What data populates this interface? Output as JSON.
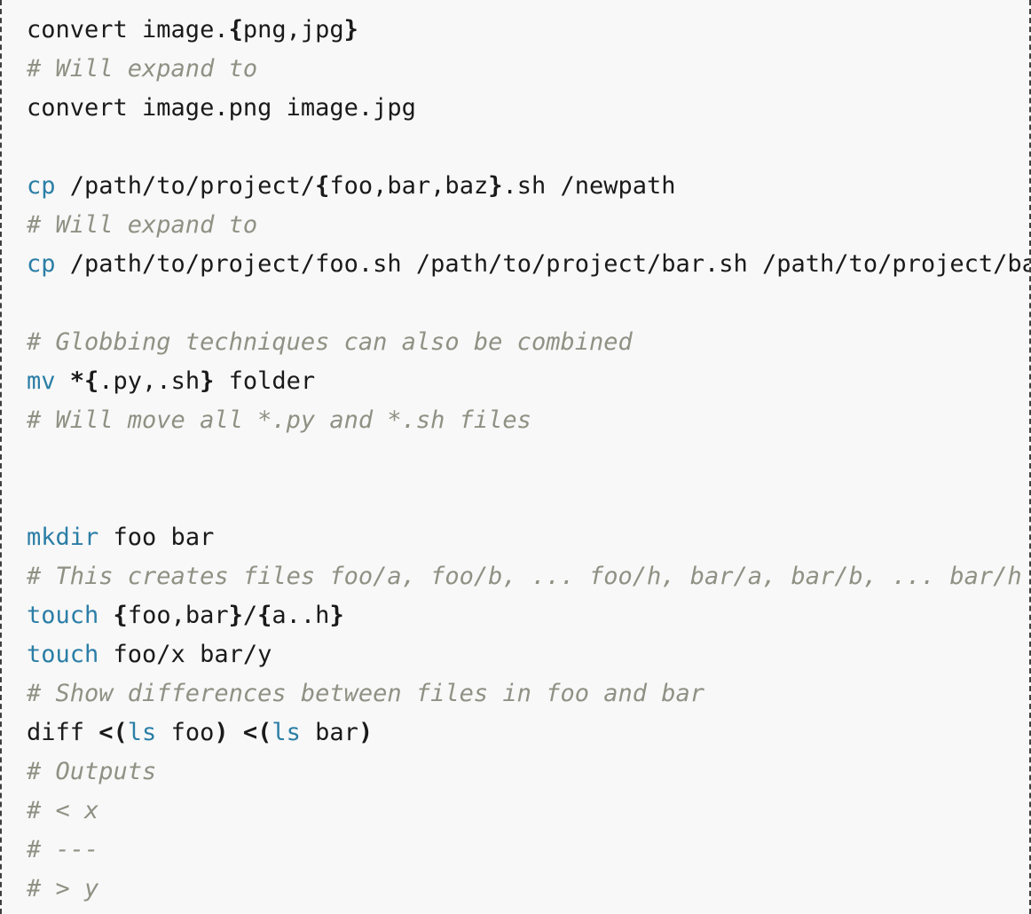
{
  "block": {
    "language": "bash",
    "background_color": "#f8f8f8",
    "border_style": "dashed",
    "border_color": "#3f3f3f",
    "colors": {
      "text": "#1a1a1a",
      "keyword": "#2b7ea6",
      "comment": "#8f9184",
      "metachar": "#1a1a1a"
    }
  },
  "lines": [
    {
      "id": "line-1",
      "type": "command",
      "text": "convert image.{png,jpg}",
      "tokens": [
        {
          "t": "convert image.",
          "k": "plain"
        },
        {
          "t": "{",
          "k": "meta"
        },
        {
          "t": "png,jpg",
          "k": "plain"
        },
        {
          "t": "}",
          "k": "meta"
        }
      ]
    },
    {
      "id": "line-2",
      "type": "comment",
      "text": "# Will expand to",
      "tokens": [
        {
          "t": "# Will expand to",
          "k": "comment"
        }
      ]
    },
    {
      "id": "line-3",
      "type": "command",
      "text": "convert image.png image.jpg",
      "tokens": [
        {
          "t": "convert image.png image.jpg",
          "k": "plain"
        }
      ]
    },
    {
      "id": "line-4",
      "type": "blank",
      "text": "",
      "tokens": []
    },
    {
      "id": "line-5",
      "type": "command",
      "text": "cp /path/to/project/{foo,bar,baz}.sh /newpath",
      "tokens": [
        {
          "t": "cp",
          "k": "keyword"
        },
        {
          "t": " /path/to/project/",
          "k": "plain"
        },
        {
          "t": "{",
          "k": "meta"
        },
        {
          "t": "foo,bar,baz",
          "k": "plain"
        },
        {
          "t": "}",
          "k": "meta"
        },
        {
          "t": ".sh /newpath",
          "k": "plain"
        }
      ]
    },
    {
      "id": "line-6",
      "type": "comment",
      "text": "# Will expand to",
      "tokens": [
        {
          "t": "# Will expand to",
          "k": "comment"
        }
      ]
    },
    {
      "id": "line-7",
      "type": "command",
      "text": "cp /path/to/project/foo.sh /path/to/project/bar.sh /path/to/project/baz.sh /newpath",
      "clipped": true,
      "visible_text": "cp /path/to/project/foo.sh /path/to/project/bar.sh /path/to/pro",
      "tokens": [
        {
          "t": "cp",
          "k": "keyword"
        },
        {
          "t": " /path/to/project/foo.sh /path/to/project/bar.sh /path/to/project/baz.sh /newpath",
          "k": "plain"
        }
      ]
    },
    {
      "id": "line-8",
      "type": "blank",
      "text": "",
      "tokens": []
    },
    {
      "id": "line-9",
      "type": "comment",
      "text": "# Globbing techniques can also be combined",
      "tokens": [
        {
          "t": "# Globbing techniques can also be combined",
          "k": "comment"
        }
      ]
    },
    {
      "id": "line-10",
      "type": "command",
      "text": "mv *{.py,.sh} folder",
      "tokens": [
        {
          "t": "mv",
          "k": "keyword"
        },
        {
          "t": " ",
          "k": "plain"
        },
        {
          "t": "*{",
          "k": "meta"
        },
        {
          "t": ".py,.sh",
          "k": "plain"
        },
        {
          "t": "}",
          "k": "meta"
        },
        {
          "t": " folder",
          "k": "plain"
        }
      ]
    },
    {
      "id": "line-11",
      "type": "comment",
      "text": "# Will move all *.py and *.sh files",
      "tokens": [
        {
          "t": "# Will move all *.py and *.sh files",
          "k": "comment"
        }
      ]
    },
    {
      "id": "line-12",
      "type": "blank",
      "text": "",
      "tokens": []
    },
    {
      "id": "line-13",
      "type": "blank",
      "text": "",
      "tokens": []
    },
    {
      "id": "line-14",
      "type": "command",
      "text": "mkdir foo bar",
      "tokens": [
        {
          "t": "mkdir",
          "k": "keyword"
        },
        {
          "t": " foo bar",
          "k": "plain"
        }
      ]
    },
    {
      "id": "line-15",
      "type": "comment",
      "text": "# This creates files foo/a, foo/b, ... foo/h, bar/a, bar/b, ... bar/h",
      "clipped": true,
      "visible_text": "# This creates files foo/a, foo/b, ... foo/h, bar/a, bar/b, ...",
      "tokens": [
        {
          "t": "# This creates files foo/a, foo/b, ... foo/h, bar/a, bar/b, ... bar/h",
          "k": "comment"
        }
      ]
    },
    {
      "id": "line-16",
      "type": "command",
      "text": "touch {foo,bar}/{a..h}",
      "tokens": [
        {
          "t": "touch",
          "k": "keyword"
        },
        {
          "t": " ",
          "k": "plain"
        },
        {
          "t": "{",
          "k": "meta"
        },
        {
          "t": "foo,bar",
          "k": "plain"
        },
        {
          "t": "}",
          "k": "meta"
        },
        {
          "t": "/",
          "k": "plain"
        },
        {
          "t": "{",
          "k": "meta"
        },
        {
          "t": "a..h",
          "k": "plain"
        },
        {
          "t": "}",
          "k": "meta"
        }
      ]
    },
    {
      "id": "line-17",
      "type": "command",
      "text": "touch foo/x bar/y",
      "tokens": [
        {
          "t": "touch",
          "k": "keyword"
        },
        {
          "t": " foo/x bar/y",
          "k": "plain"
        }
      ]
    },
    {
      "id": "line-18",
      "type": "comment",
      "text": "# Show differences between files in foo and bar",
      "tokens": [
        {
          "t": "# Show differences between files in foo and bar",
          "k": "comment"
        }
      ]
    },
    {
      "id": "line-19",
      "type": "command",
      "text": "diff <(ls foo) <(ls bar)",
      "tokens": [
        {
          "t": "diff ",
          "k": "plain"
        },
        {
          "t": "<(",
          "k": "meta"
        },
        {
          "t": "ls",
          "k": "keyword"
        },
        {
          "t": " foo",
          "k": "plain"
        },
        {
          "t": ")",
          "k": "meta"
        },
        {
          "t": " ",
          "k": "plain"
        },
        {
          "t": "<(",
          "k": "meta"
        },
        {
          "t": "ls",
          "k": "keyword"
        },
        {
          "t": " bar",
          "k": "plain"
        },
        {
          "t": ")",
          "k": "meta"
        }
      ]
    },
    {
      "id": "line-20",
      "type": "comment",
      "text": "# Outputs",
      "tokens": [
        {
          "t": "# Outputs",
          "k": "comment"
        }
      ]
    },
    {
      "id": "line-21",
      "type": "comment",
      "text": "# < x",
      "tokens": [
        {
          "t": "# < x",
          "k": "comment"
        }
      ]
    },
    {
      "id": "line-22",
      "type": "comment",
      "text": "# ---",
      "tokens": [
        {
          "t": "# ---",
          "k": "comment"
        }
      ]
    },
    {
      "id": "line-23",
      "type": "comment",
      "text": "# > y",
      "tokens": [
        {
          "t": "# > y",
          "k": "comment"
        }
      ]
    }
  ]
}
